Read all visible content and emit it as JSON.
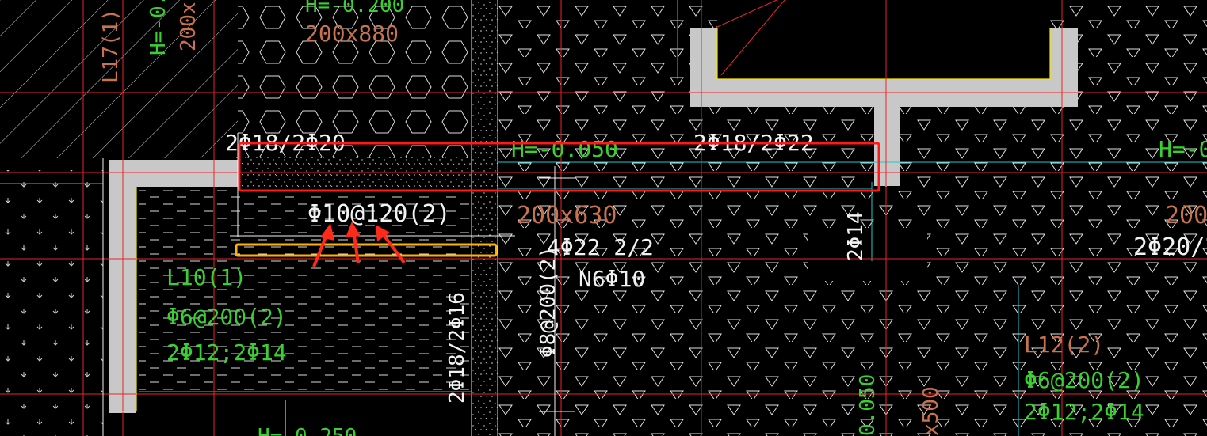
{
  "drawing": {
    "labels": {
      "h_top": "H=-0.200",
      "top_size": "200x880",
      "l7_fragment": "L17(1)",
      "h_left_top": "H=-0.",
      "left_top_size": "200x",
      "rebar_left": "2Φ18/2Φ20",
      "rebar_right": "2Φ18/2Φ22",
      "h_mid": "H=-0.050",
      "h_right_edge": "H=-0.",
      "stirrup": "Φ10@120(2)",
      "beam_size_mid": "200x630",
      "rebar_4phi22": "4Φ22 2/2",
      "n6": "N6Φ10",
      "phi8": "Φ8@200(2)",
      "vert_rebar_bottom": "2Φ18/2Φ16",
      "vert_2phi14": "2Φ14",
      "size_right_edge": "200",
      "rebar_right_edge": "2Φ20/2",
      "l10": "L10(1)",
      "l10_stirrup": "Φ6@200(2)",
      "l10_rebar": "2Φ12;2Φ14",
      "l12": "L12(2)",
      "l12_stirrup": "Φ6@200(2)",
      "l12_rebar": "2Φ12;2Φ14",
      "bottom_h": "H=-0.250",
      "bottom_vert_h": "0.050",
      "bottom_vert_size": "x500"
    },
    "colors": {
      "background": "#000000",
      "grid_line": "#e8262b",
      "wall_fill": "#c8c8c8",
      "green_text": "#39d12f",
      "orange_text": "#c8724f",
      "white_text": "#f2f2f2",
      "cyan_line": "#1fc7c7",
      "yellow_outline": "#f5e400",
      "highlight_box": "#ff1a1a",
      "beam_highlight": "#ffb300",
      "arrow": "#ff2a1a"
    },
    "icons": [
      "arrow-up-icon"
    ]
  }
}
